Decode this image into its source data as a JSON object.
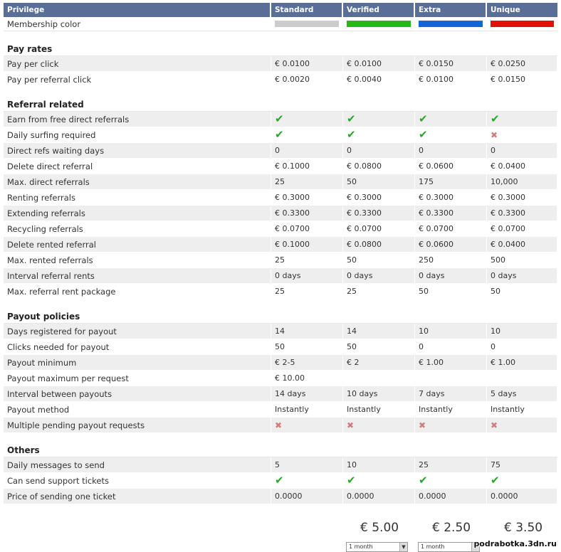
{
  "header": [
    "Privilege",
    "Standard",
    "Verified",
    "Extra",
    "Unique"
  ],
  "membership": {
    "label": "Membership color",
    "colors": [
      "#cccccc",
      "#22bb11",
      "#1166dd",
      "#dd1111"
    ]
  },
  "sections": [
    {
      "title": "Pay rates",
      "rows": [
        {
          "label": "Pay per click",
          "values": [
            "€ 0.0100",
            "€ 0.0100",
            "€ 0.0150",
            "€ 0.0250"
          ]
        },
        {
          "label": "Pay per referral click",
          "values": [
            "€ 0.0020",
            "€ 0.0040",
            "€ 0.0100",
            "€ 0.0150"
          ]
        }
      ]
    },
    {
      "title": "Referral related",
      "rows": [
        {
          "label": "Earn from free direct referrals",
          "values": [
            "check",
            "check",
            "check",
            "check"
          ]
        },
        {
          "label": "Daily surfing required",
          "values": [
            "check",
            "check",
            "check",
            "cross"
          ]
        },
        {
          "label": "Direct refs waiting days",
          "values": [
            "0",
            "0",
            "0",
            "0"
          ]
        },
        {
          "label": "Delete direct referral",
          "values": [
            "€ 0.1000",
            "€ 0.0800",
            "€ 0.0600",
            "€ 0.0400"
          ]
        },
        {
          "label": "Max. direct referrals",
          "values": [
            "25",
            "50",
            "175",
            "10,000"
          ]
        },
        {
          "label": "Renting referrals",
          "values": [
            "€ 0.3000",
            "€ 0.3000",
            "€ 0.3000",
            "€ 0.3000"
          ]
        },
        {
          "label": "Extending referrals",
          "values": [
            "€ 0.3300",
            "€ 0.3300",
            "€ 0.3300",
            "€ 0.3300"
          ]
        },
        {
          "label": "Recycling referrals",
          "values": [
            "€ 0.0700",
            "€ 0.0700",
            "€ 0.0700",
            "€ 0.0700"
          ]
        },
        {
          "label": "Delete rented referral",
          "values": [
            "€ 0.1000",
            "€ 0.0800",
            "€ 0.0600",
            "€ 0.0400"
          ]
        },
        {
          "label": "Max. rented referrals",
          "values": [
            "25",
            "50",
            "250",
            "500"
          ]
        },
        {
          "label": "Interval referral rents",
          "values": [
            "0 days",
            "0 days",
            "0 days",
            "0 days"
          ]
        },
        {
          "label": "Max. referral rent package",
          "values": [
            "25",
            "25",
            "50",
            "50"
          ]
        }
      ]
    },
    {
      "title": "Payout policies",
      "rows": [
        {
          "label": "Days registered for payout",
          "values": [
            "14",
            "14",
            "10",
            "10"
          ]
        },
        {
          "label": "Clicks needed for payout",
          "values": [
            "50",
            "50",
            "0",
            "0"
          ]
        },
        {
          "label": "Payout minimum",
          "values": [
            "€ 2-5",
            "€ 2",
            "€ 1.00",
            "€ 1.00"
          ]
        },
        {
          "label": "Payout maximum per request",
          "values": [
            "€ 10.00",
            "",
            "",
            ""
          ]
        },
        {
          "label": "Interval between payouts",
          "values": [
            "14 days",
            "10 days",
            "7 days",
            "5 days"
          ]
        },
        {
          "label": "Payout method",
          "values": [
            "Instantly",
            "Instantly",
            "Instantly",
            "Instantly"
          ]
        },
        {
          "label": "Multiple pending payout requests",
          "values": [
            "cross",
            "cross",
            "cross",
            "cross"
          ]
        }
      ]
    },
    {
      "title": "Others",
      "rows": [
        {
          "label": "Daily messages to send",
          "values": [
            "5",
            "10",
            "25",
            "75"
          ]
        },
        {
          "label": "Can send support tickets",
          "values": [
            "check",
            "check",
            "check",
            "check"
          ]
        },
        {
          "label": "Price of sending one ticket",
          "values": [
            "0.0000",
            "0.0000",
            "0.0000",
            "0.0000"
          ]
        }
      ]
    }
  ],
  "prices": [
    "€ 5.00",
    "€ 2.50",
    "€ 3.50"
  ],
  "period_select": [
    "1 month",
    "1 month"
  ],
  "watermark": "podrabotka.3dn.ru"
}
